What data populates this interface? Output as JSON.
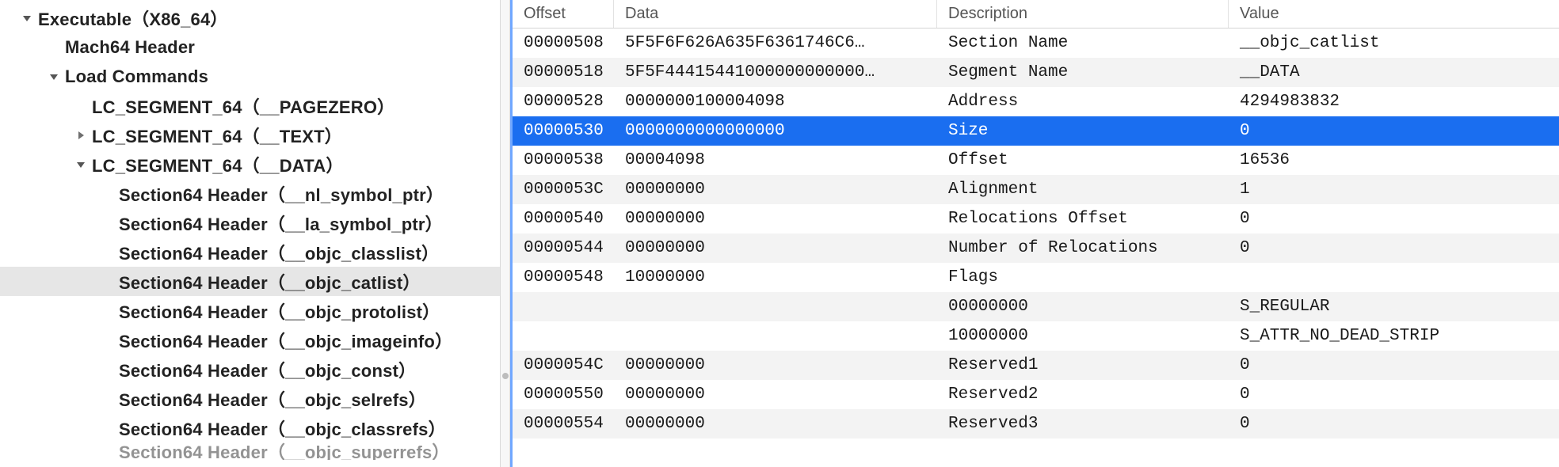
{
  "tree": [
    {
      "indent": 0,
      "disclosure": "down",
      "bold": true,
      "label": "Executable（X86_64）"
    },
    {
      "indent": 1,
      "disclosure": "none",
      "bold": true,
      "label": "Mach64 Header"
    },
    {
      "indent": 1,
      "disclosure": "down",
      "bold": true,
      "label": "Load Commands"
    },
    {
      "indent": 2,
      "disclosure": "none",
      "bold": true,
      "label": "LC_SEGMENT_64（__PAGEZERO）"
    },
    {
      "indent": 2,
      "disclosure": "right",
      "bold": true,
      "label": "LC_SEGMENT_64（__TEXT）"
    },
    {
      "indent": 2,
      "disclosure": "down",
      "bold": true,
      "label": "LC_SEGMENT_64（__DATA）"
    },
    {
      "indent": 3,
      "disclosure": "none",
      "bold": true,
      "label": "Section64 Header（__nl_symbol_ptr）"
    },
    {
      "indent": 3,
      "disclosure": "none",
      "bold": true,
      "label": "Section64 Header（__la_symbol_ptr）"
    },
    {
      "indent": 3,
      "disclosure": "none",
      "bold": true,
      "label": "Section64 Header（__objc_classlist）"
    },
    {
      "indent": 3,
      "disclosure": "none",
      "bold": true,
      "label": "Section64 Header（__objc_catlist）",
      "selected": true
    },
    {
      "indent": 3,
      "disclosure": "none",
      "bold": true,
      "label": "Section64 Header（__objc_protolist）"
    },
    {
      "indent": 3,
      "disclosure": "none",
      "bold": true,
      "label": "Section64 Header（__objc_imageinfo）"
    },
    {
      "indent": 3,
      "disclosure": "none",
      "bold": true,
      "label": "Section64 Header（__objc_const）"
    },
    {
      "indent": 3,
      "disclosure": "none",
      "bold": true,
      "label": "Section64 Header（__objc_selrefs）"
    },
    {
      "indent": 3,
      "disclosure": "none",
      "bold": true,
      "label": "Section64 Header（__objc_classrefs）"
    },
    {
      "indent": 3,
      "disclosure": "none",
      "bold": true,
      "label": "Section64 Header（__objc_superrefs）",
      "cut": true
    }
  ],
  "columns": {
    "offset": "Offset",
    "data": "Data",
    "description": "Description",
    "value": "Value"
  },
  "rows": [
    {
      "offset": "00000508",
      "data": "5F5F6F626A635F6361746C6…",
      "desc": "Section Name",
      "value": "__objc_catlist"
    },
    {
      "offset": "00000518",
      "data": "5F5F44415441000000000000…",
      "desc": "Segment Name",
      "value": "__DATA",
      "alt": true
    },
    {
      "offset": "00000528",
      "data": "0000000100004098",
      "desc": "Address",
      "value": "4294983832"
    },
    {
      "offset": "00000530",
      "data": "0000000000000000",
      "desc": "Size",
      "value": "0",
      "sel": true
    },
    {
      "offset": "00000538",
      "data": "00004098",
      "desc": "Offset",
      "value": "16536"
    },
    {
      "offset": "0000053C",
      "data": "00000000",
      "desc": "Alignment",
      "value": "1",
      "alt": true
    },
    {
      "offset": "00000540",
      "data": "00000000",
      "desc": "Relocations Offset",
      "value": "0"
    },
    {
      "offset": "00000544",
      "data": "00000000",
      "desc": "Number of Relocations",
      "value": "0",
      "alt": true
    },
    {
      "offset": "00000548",
      "data": "10000000",
      "desc": "Flags",
      "value": ""
    },
    {
      "offset": "",
      "data": "",
      "desc": "00000000",
      "value": "S_REGULAR",
      "alt": true
    },
    {
      "offset": "",
      "data": "",
      "desc": "10000000",
      "value": "S_ATTR_NO_DEAD_STRIP"
    },
    {
      "offset": "0000054C",
      "data": "00000000",
      "desc": "Reserved1",
      "value": "0",
      "alt": true
    },
    {
      "offset": "00000550",
      "data": "00000000",
      "desc": "Reserved2",
      "value": "0"
    },
    {
      "offset": "00000554",
      "data": "00000000",
      "desc": "Reserved3",
      "value": "0",
      "alt": true
    }
  ]
}
